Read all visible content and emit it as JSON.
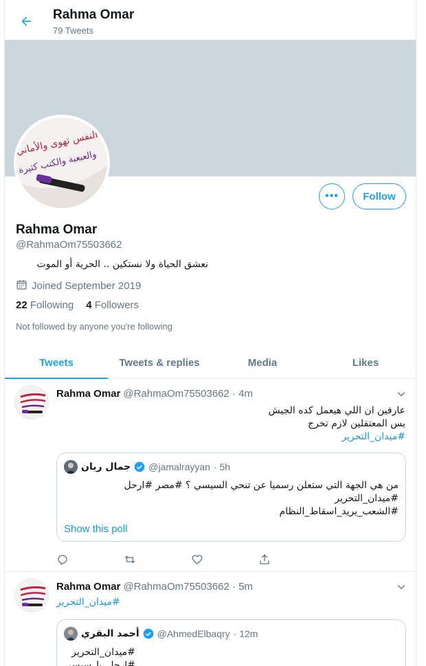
{
  "header": {
    "back_icon": "arrow-left-icon",
    "name": "Rahma Omar",
    "tweet_count": "79 Tweets"
  },
  "colors": {
    "accent": "#1da1f2",
    "banner": "#ccd6dd",
    "muted": "#657786",
    "link": "#1b95e0"
  },
  "profile": {
    "name": "Rahma Omar",
    "handle": "@RahmaOm75503662",
    "bio": "نعشق الحياة ولا نستكين .. الحرية أو الموت",
    "joined": "Joined September 2019",
    "following_count": "22",
    "following_label": "Following",
    "followers_count": "4",
    "followers_label": "Followers",
    "not_followed": "Not followed by anyone you're following",
    "follow_button": "Follow",
    "more_button": "•••",
    "avatar_text_line1": "النفس تهوى والأماني جمة",
    "avatar_text_line2": "والعبعبة والكتب كثيرة"
  },
  "tabs": [
    "Tweets",
    "Tweets & replies",
    "Media",
    "Likes"
  ],
  "tweets": [
    {
      "name": "Rahma Omar",
      "handle": "@RahmaOm75503662",
      "time": "· 4m",
      "line1": "عارفين ان اللي هيعمل كده الجيش",
      "line2": "بس المعتقلين لازم تخرج",
      "hashtag": "#ميدان_التحرير",
      "quote": {
        "name": "جمال ريان",
        "handle": "@jamalrayyan",
        "time": "· 5h",
        "line1": "من هي الجهة التي ستعلن رسميا عن تنحي السيسي ؟ #مصر #ارحل",
        "line2": "#ميدان_التحرير",
        "line3": "#الشعب_يريد_اسقاط_النظام",
        "poll": "Show this poll"
      }
    },
    {
      "name": "Rahma Omar",
      "handle": "@RahmaOm75503662",
      "time": "· 5m",
      "hashtag": "#ميدان_التحرير",
      "quote": {
        "name": "أحمد البقري",
        "handle": "@AhmedElbaqry",
        "time": "· 12m",
        "line1": "#ميدان_التحرير",
        "line2": "#ارحل_يا_سيسي"
      }
    }
  ],
  "actions": [
    "reply-icon",
    "retweet-icon",
    "like-icon",
    "share-icon"
  ]
}
